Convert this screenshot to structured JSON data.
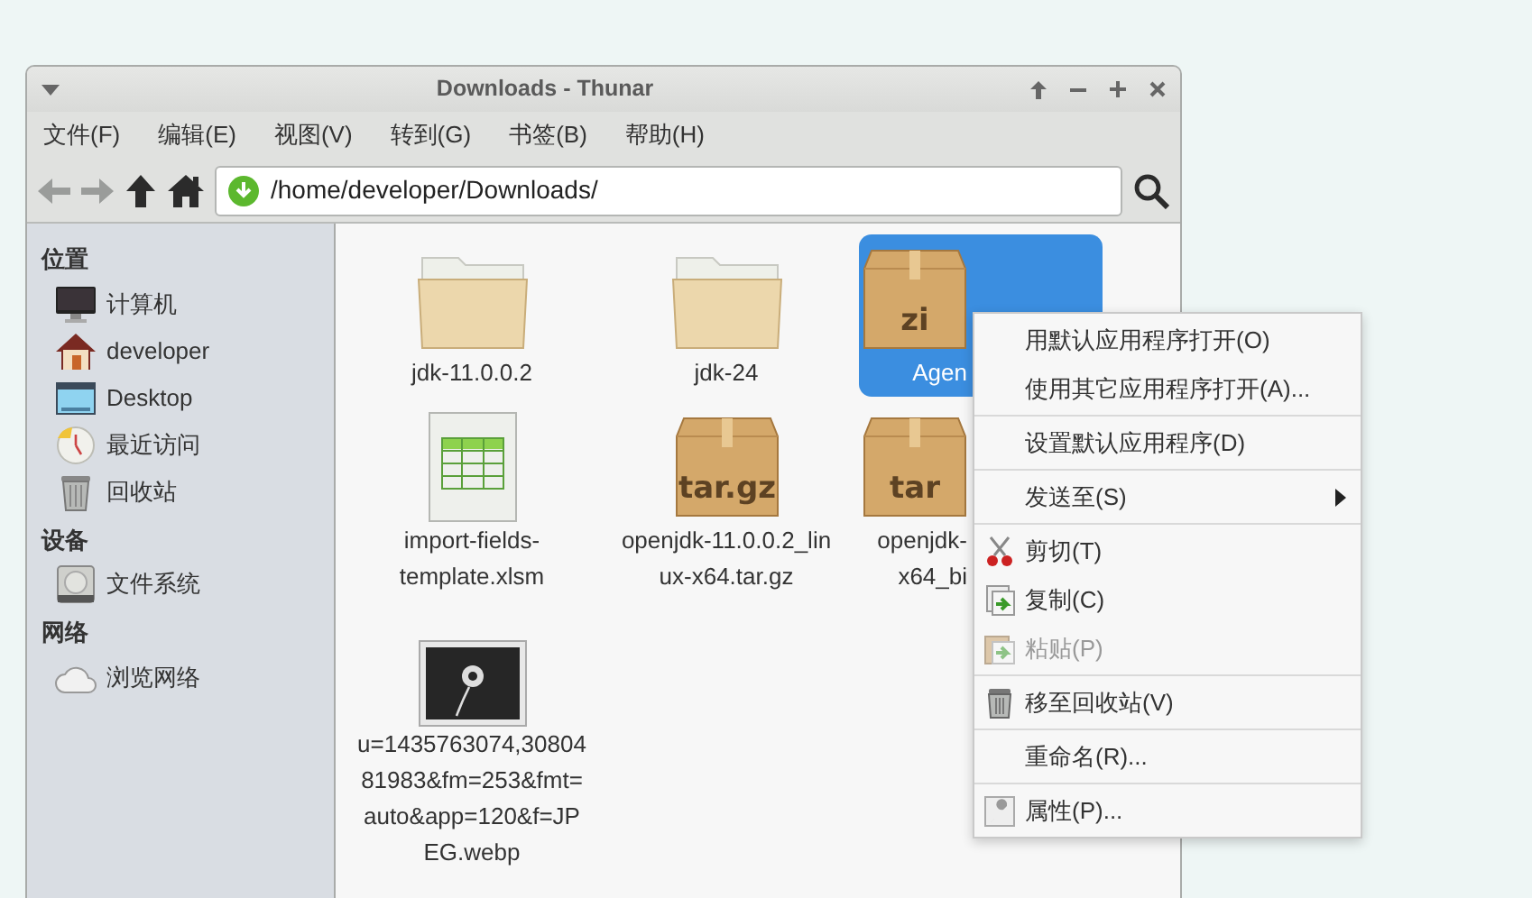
{
  "window": {
    "title": "Downloads - Thunar"
  },
  "menubar": [
    "文件(F)",
    "编辑(E)",
    "视图(V)",
    "转到(G)",
    "书签(B)",
    "帮助(H)"
  ],
  "toolbar": {
    "back_disabled": true,
    "forward_disabled": true,
    "address": "/home/developer/Downloads/"
  },
  "sidebar": [
    {
      "heading": "位置",
      "items": [
        {
          "label": "计算机",
          "kind": "computer"
        },
        {
          "label": "developer",
          "kind": "home"
        },
        {
          "label": "Desktop",
          "kind": "desktop"
        },
        {
          "label": "最近访问",
          "kind": "recent"
        },
        {
          "label": "回收站",
          "kind": "trash"
        }
      ]
    },
    {
      "heading": "设备",
      "items": [
        {
          "label": "文件系统",
          "kind": "drive"
        }
      ]
    },
    {
      "heading": "网络",
      "items": [
        {
          "label": "浏览网络",
          "kind": "network"
        }
      ]
    }
  ],
  "files": [
    {
      "kind": "folder",
      "lines": [
        "jdk-11.0.0.2"
      ],
      "selected": false
    },
    {
      "kind": "folder",
      "lines": [
        "jdk-24"
      ],
      "selected": false
    },
    {
      "kind": "archive",
      "badge": "zi",
      "lines": [
        "Agen"
      ],
      "selected": true
    },
    {
      "kind": "spreadsheet",
      "lines": [
        "import-fields-",
        "template.xlsm"
      ],
      "selected": false
    },
    {
      "kind": "archive",
      "badge": "tar.gz",
      "lines": [
        "openjdk-11.0.0.2_lin",
        "ux-x64.tar.gz"
      ],
      "selected": false
    },
    {
      "kind": "archive",
      "badge": "tar",
      "lines": [
        "openjdk-",
        "x64_bi"
      ],
      "selected": false
    },
    {
      "kind": "image",
      "lines": [
        "u=1435763074,30804",
        "81983&fm=253&fmt=",
        "auto&app=120&f=JP",
        "EG.webp"
      ],
      "selected": false
    }
  ],
  "context_menu": [
    [
      {
        "label": "用默认应用程序打开(O)",
        "disabled": false
      },
      {
        "label": "使用其它应用程序打开(A)...",
        "disabled": false
      }
    ],
    [
      {
        "label": "设置默认应用程序(D)",
        "disabled": false
      }
    ],
    [
      {
        "label": "发送至(S)",
        "disabled": false,
        "submenu": true
      }
    ],
    [
      {
        "label": "剪切(T)",
        "kind": "cut",
        "disabled": false
      },
      {
        "label": "复制(C)",
        "kind": "copy",
        "disabled": false
      },
      {
        "label": "粘贴(P)",
        "kind": "paste",
        "disabled": true
      }
    ],
    [
      {
        "label": "移至回收站(V)",
        "kind": "trash",
        "disabled": false
      }
    ],
    [
      {
        "label": "重命名(R)...",
        "disabled": false
      }
    ],
    [
      {
        "label": "属性(P)...",
        "kind": "properties",
        "disabled": false
      }
    ]
  ]
}
